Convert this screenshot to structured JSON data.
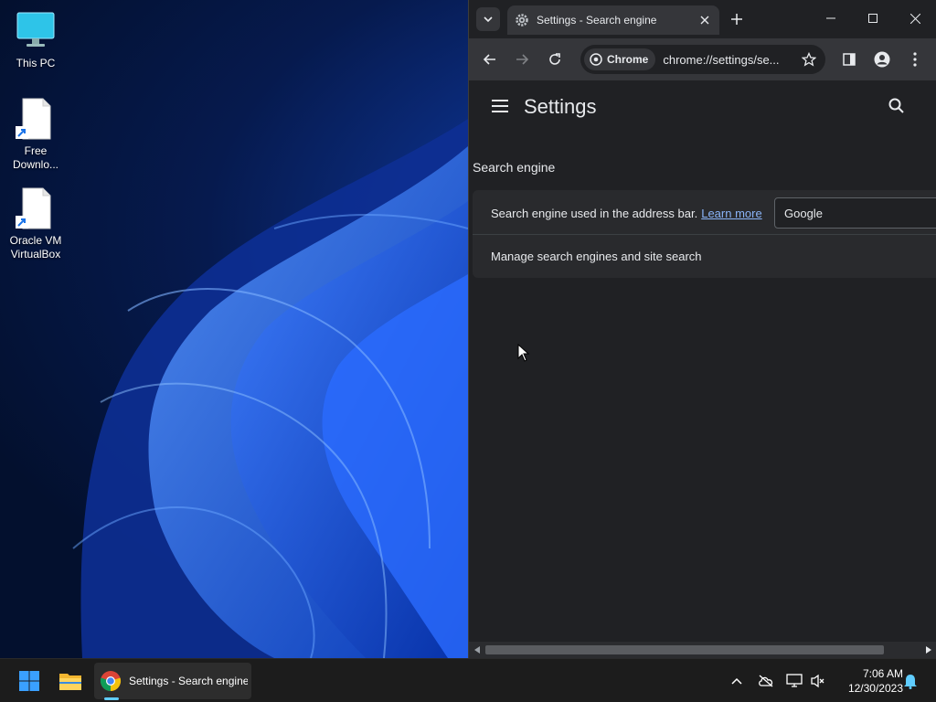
{
  "desktop": {
    "icons": [
      {
        "label": "This PC",
        "icon": "monitor-icon"
      },
      {
        "label": "Free Downlo...",
        "icon": "shortcut-file-icon"
      },
      {
        "label": "Oracle VM VirtualBox",
        "icon": "shortcut-file-icon"
      }
    ]
  },
  "browser": {
    "tab": {
      "title": "Settings - Search engine",
      "icon": "gear-icon"
    },
    "window_buttons": [
      "minimize",
      "maximize",
      "close"
    ],
    "omnibox": {
      "chip_label": "Chrome",
      "url": "chrome://settings/se..."
    },
    "page": {
      "title": "Settings",
      "section_title": "Search engine",
      "row1": {
        "text": "Search engine used in the address bar.",
        "link": "Learn more"
      },
      "engine_select": {
        "value": "Google"
      },
      "row2": {
        "text": "Manage search engines and site search"
      }
    }
  },
  "taskbar": {
    "chrome_task_label": "Settings - Search engine",
    "clock": {
      "time": "7:06 AM",
      "date": "12/30/2023"
    }
  },
  "colors": {
    "accent": "#8ab4f8",
    "window_bg": "#202124",
    "toolbar_bg": "#35363a",
    "taskbar_bg": "#1c1c1c",
    "desktop_blue": "#1e5bd8"
  }
}
